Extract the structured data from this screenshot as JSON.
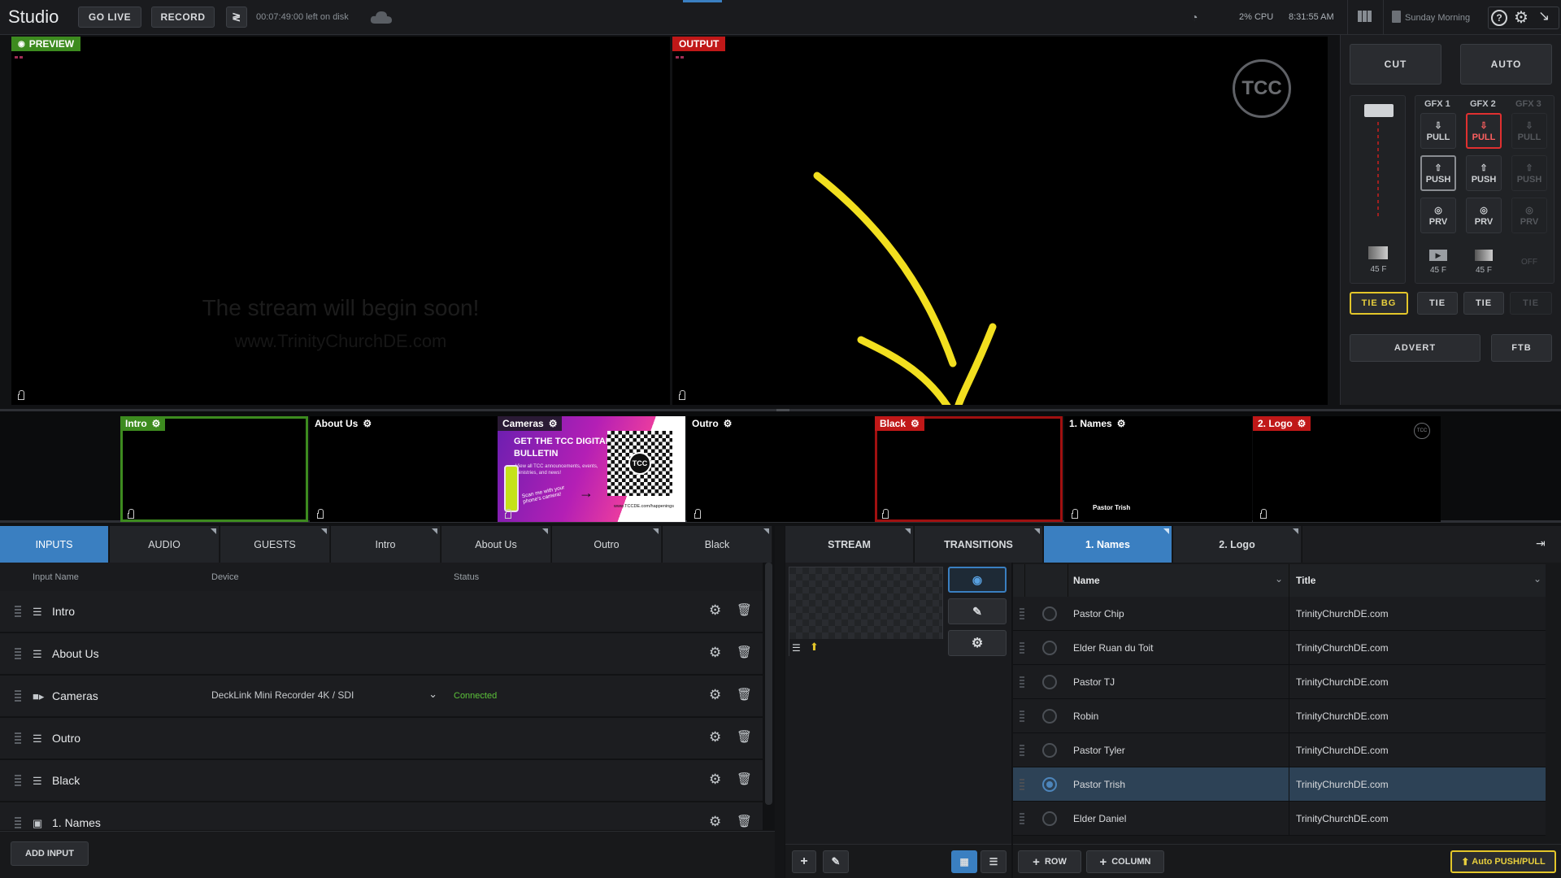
{
  "app": {
    "title": "Studio",
    "go_live": "GO LIVE",
    "record": "RECORD",
    "disk": "00:07:49:00 left on disk",
    "cpu": "2% CPU",
    "clock": "8:31:55 AM",
    "project": "Sunday Morning"
  },
  "preview": {
    "label": "PREVIEW",
    "line1": "The stream will begin soon!",
    "line2": "www.TrinityChurchDE.com"
  },
  "output": {
    "label": "OUTPUT",
    "logo": "TCC"
  },
  "controls": {
    "cut": "CUT",
    "auto": "AUTO",
    "gfx": [
      {
        "name": "GFX 1",
        "pull": "PULL",
        "push": "PUSH",
        "prv": "PRV",
        "dur": "45 F",
        "tie": "TIE"
      },
      {
        "name": "GFX 2",
        "pull": "PULL",
        "push": "PUSH",
        "prv": "PRV",
        "dur": "45 F",
        "tie": "TIE"
      },
      {
        "name": "GFX 3",
        "pull": "PULL",
        "push": "PUSH",
        "prv": "PRV",
        "dur": "OFF",
        "tie": "TIE"
      }
    ],
    "bg_dur": "45 F",
    "tie_bg": "TIE BG",
    "advert": "ADVERT",
    "ftb": "FTB"
  },
  "thumbnails": [
    {
      "label": "Intro",
      "state": "preview"
    },
    {
      "label": "About Us",
      "state": "none"
    },
    {
      "label": "Cameras",
      "state": "none",
      "card_title": "GET THE TCC DIGITAL BULLETIN",
      "card_sub": "View all TCC announcements, events, ministries, and news!",
      "card_scan": "Scan me with your phone's camera!",
      "card_url": "www.TCCDE.com/happenings"
    },
    {
      "label": "Outro",
      "state": "none"
    },
    {
      "label": "Black",
      "state": "output"
    },
    {
      "label": "1. Names",
      "state": "none",
      "lower_third": "Pastor Trish"
    },
    {
      "label": "2. Logo",
      "state": "output-gfx"
    }
  ],
  "input_tabs": [
    {
      "label": "INPUTS",
      "active": true
    },
    {
      "label": "AUDIO"
    },
    {
      "label": "GUESTS"
    },
    {
      "label": "Intro"
    },
    {
      "label": "About Us"
    },
    {
      "label": "Outro"
    },
    {
      "label": "Black"
    }
  ],
  "inputs_header": {
    "name": "Input Name",
    "device": "Device",
    "status": "Status"
  },
  "inputs": [
    {
      "name": "Intro",
      "icon": "playlist-icon"
    },
    {
      "name": "About Us",
      "icon": "playlist-icon"
    },
    {
      "name": "Cameras",
      "icon": "camera-icon",
      "device": "DeckLink Mini Recorder 4K / SDI",
      "status": "Connected"
    },
    {
      "name": "Outro",
      "icon": "playlist-icon"
    },
    {
      "name": "Black",
      "icon": "playlist-icon"
    },
    {
      "name": "1. Names",
      "icon": "image-icon"
    }
  ],
  "add_input": "ADD INPUT",
  "gfx_tabs": [
    {
      "label": "STREAM"
    },
    {
      "label": "TRANSITIONS"
    },
    {
      "label": "1. Names",
      "active": true
    },
    {
      "label": "2. Logo"
    }
  ],
  "grid_header": {
    "col1": "Name",
    "col2": "Title"
  },
  "grid_rows": [
    {
      "name": "Pastor Chip",
      "title": "TrinityChurchDE.com"
    },
    {
      "name": "Elder Ruan du Toit",
      "title": "TrinityChurchDE.com"
    },
    {
      "name": "Pastor TJ",
      "title": "TrinityChurchDE.com"
    },
    {
      "name": "Robin",
      "title": "TrinityChurchDE.com"
    },
    {
      "name": "Pastor Tyler",
      "title": "TrinityChurchDE.com"
    },
    {
      "name": "Pastor Trish",
      "title": "TrinityChurchDE.com",
      "selected": true
    },
    {
      "name": "Elder Daniel",
      "title": "TrinityChurchDE.com"
    }
  ],
  "grid_buttons": {
    "row": "ROW",
    "column": "COLUMN",
    "auto": "Auto PUSH/PULL"
  },
  "colors": {
    "accent": "#3a7fc1",
    "preview": "#3d8b1f",
    "output": "#c01818",
    "annotation": "#f2df1f",
    "connected": "#5cc23a"
  }
}
